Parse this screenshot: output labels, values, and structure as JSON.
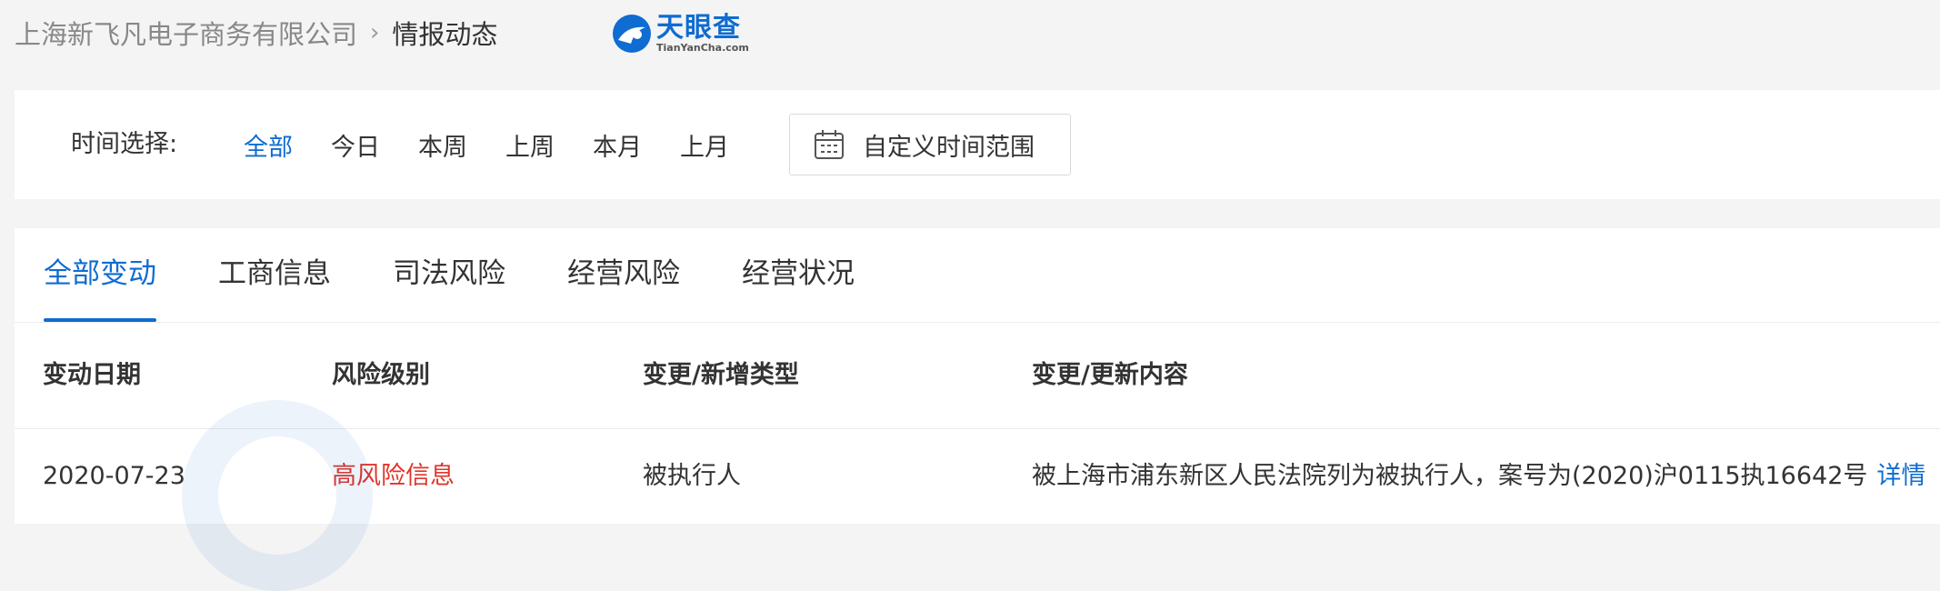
{
  "breadcrumb": {
    "company": "上海新飞凡电子商务有限公司",
    "separator": "›",
    "page": "情报动态"
  },
  "logo": {
    "name_cn": "天眼查",
    "name_en": "TianYanCha.com",
    "brand_color": "#0f6cd1"
  },
  "filter": {
    "label": "时间选择:",
    "options": [
      "全部",
      "今日",
      "本周",
      "上周",
      "本月",
      "上月"
    ],
    "active_option": "全部",
    "custom_range_label": "自定义时间范围",
    "custom_range_icon": "calendar-icon"
  },
  "tabs": [
    {
      "label": "全部变动",
      "active": true
    },
    {
      "label": "工商信息",
      "active": false
    },
    {
      "label": "司法风险",
      "active": false
    },
    {
      "label": "经营风险",
      "active": false
    },
    {
      "label": "经营状况",
      "active": false
    }
  ],
  "table": {
    "headers": [
      "变动日期",
      "风险级别",
      "变更/新增类型",
      "变更/更新内容"
    ],
    "rows": [
      {
        "date": "2020-07-23",
        "risk": "高风险信息",
        "type": "被执行人",
        "content": "被上海市浦东新区人民法院列为被执行人，案号为(2020)沪0115执16642号",
        "link": "详情"
      }
    ]
  },
  "colors": {
    "accent": "#0f6cd1",
    "risk_high": "#e0352b"
  }
}
